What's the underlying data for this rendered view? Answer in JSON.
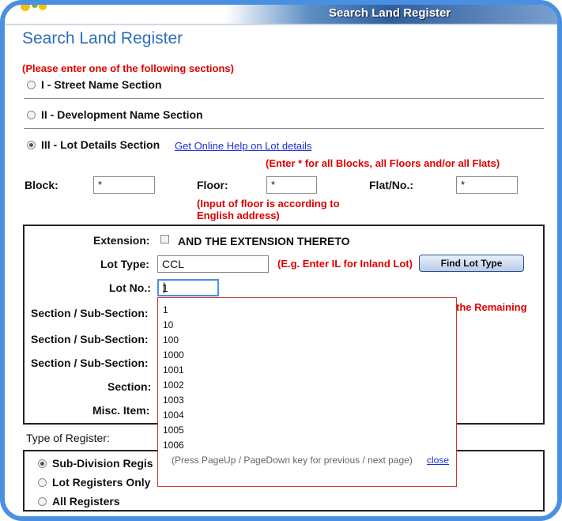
{
  "header": {
    "banner_title": "Search Land Register"
  },
  "page_title": "Search Land Register",
  "instructions": "(Please enter one of the following sections)",
  "sections": [
    {
      "label": "I - Street Name Section",
      "selected": false
    },
    {
      "label": "II - Development Name Section",
      "selected": false
    },
    {
      "label": "III - Lot Details Section",
      "selected": true
    }
  ],
  "help_link": "Get Online Help on Lot details",
  "wildcard_note": "(Enter * for all Blocks, all Floors and/or all Flats)",
  "fields": {
    "block": {
      "label": "Block:",
      "value": "*"
    },
    "floor": {
      "label": "Floor:",
      "value": "*"
    },
    "flat": {
      "label": "Flat/No.:",
      "value": "*"
    }
  },
  "floor_note_line1": "(Input of floor is according to",
  "floor_note_line2": "English address)",
  "lot": {
    "extension_label": "Extension:",
    "extension_text": "AND THE EXTENSION THERETO",
    "lot_type_label": "Lot Type:",
    "lot_type_value": "CCL",
    "lot_type_hint": "(E.g. Enter IL for Inland Lot)",
    "find_button": "Find Lot Type",
    "lot_no_label": "Lot No.:",
    "lot_no_value": "1",
    "section_sub_label": "Section / Sub-Section:",
    "section_label": "Section:",
    "misc_label": "Misc. Item:",
    "remaining_text": "the Remaining"
  },
  "register": {
    "label": "Type of Register:",
    "options": [
      {
        "label": "Sub-Division Regis",
        "selected": true
      },
      {
        "label": "Lot Registers Only",
        "selected": false
      },
      {
        "label": "All Registers",
        "selected": false
      }
    ]
  },
  "dropdown": {
    "options": [
      "1",
      "10",
      "100",
      "1000",
      "1001",
      "1002",
      "1003",
      "1004",
      "1005",
      "1006"
    ],
    "hint": "(Press PageUp / PageDown key for previous / next page)",
    "close": "close"
  },
  "colors": {
    "accent": "#4a90e2",
    "title": "#2a6ebc",
    "warning": "#e00000",
    "link": "#1a2fd6"
  }
}
